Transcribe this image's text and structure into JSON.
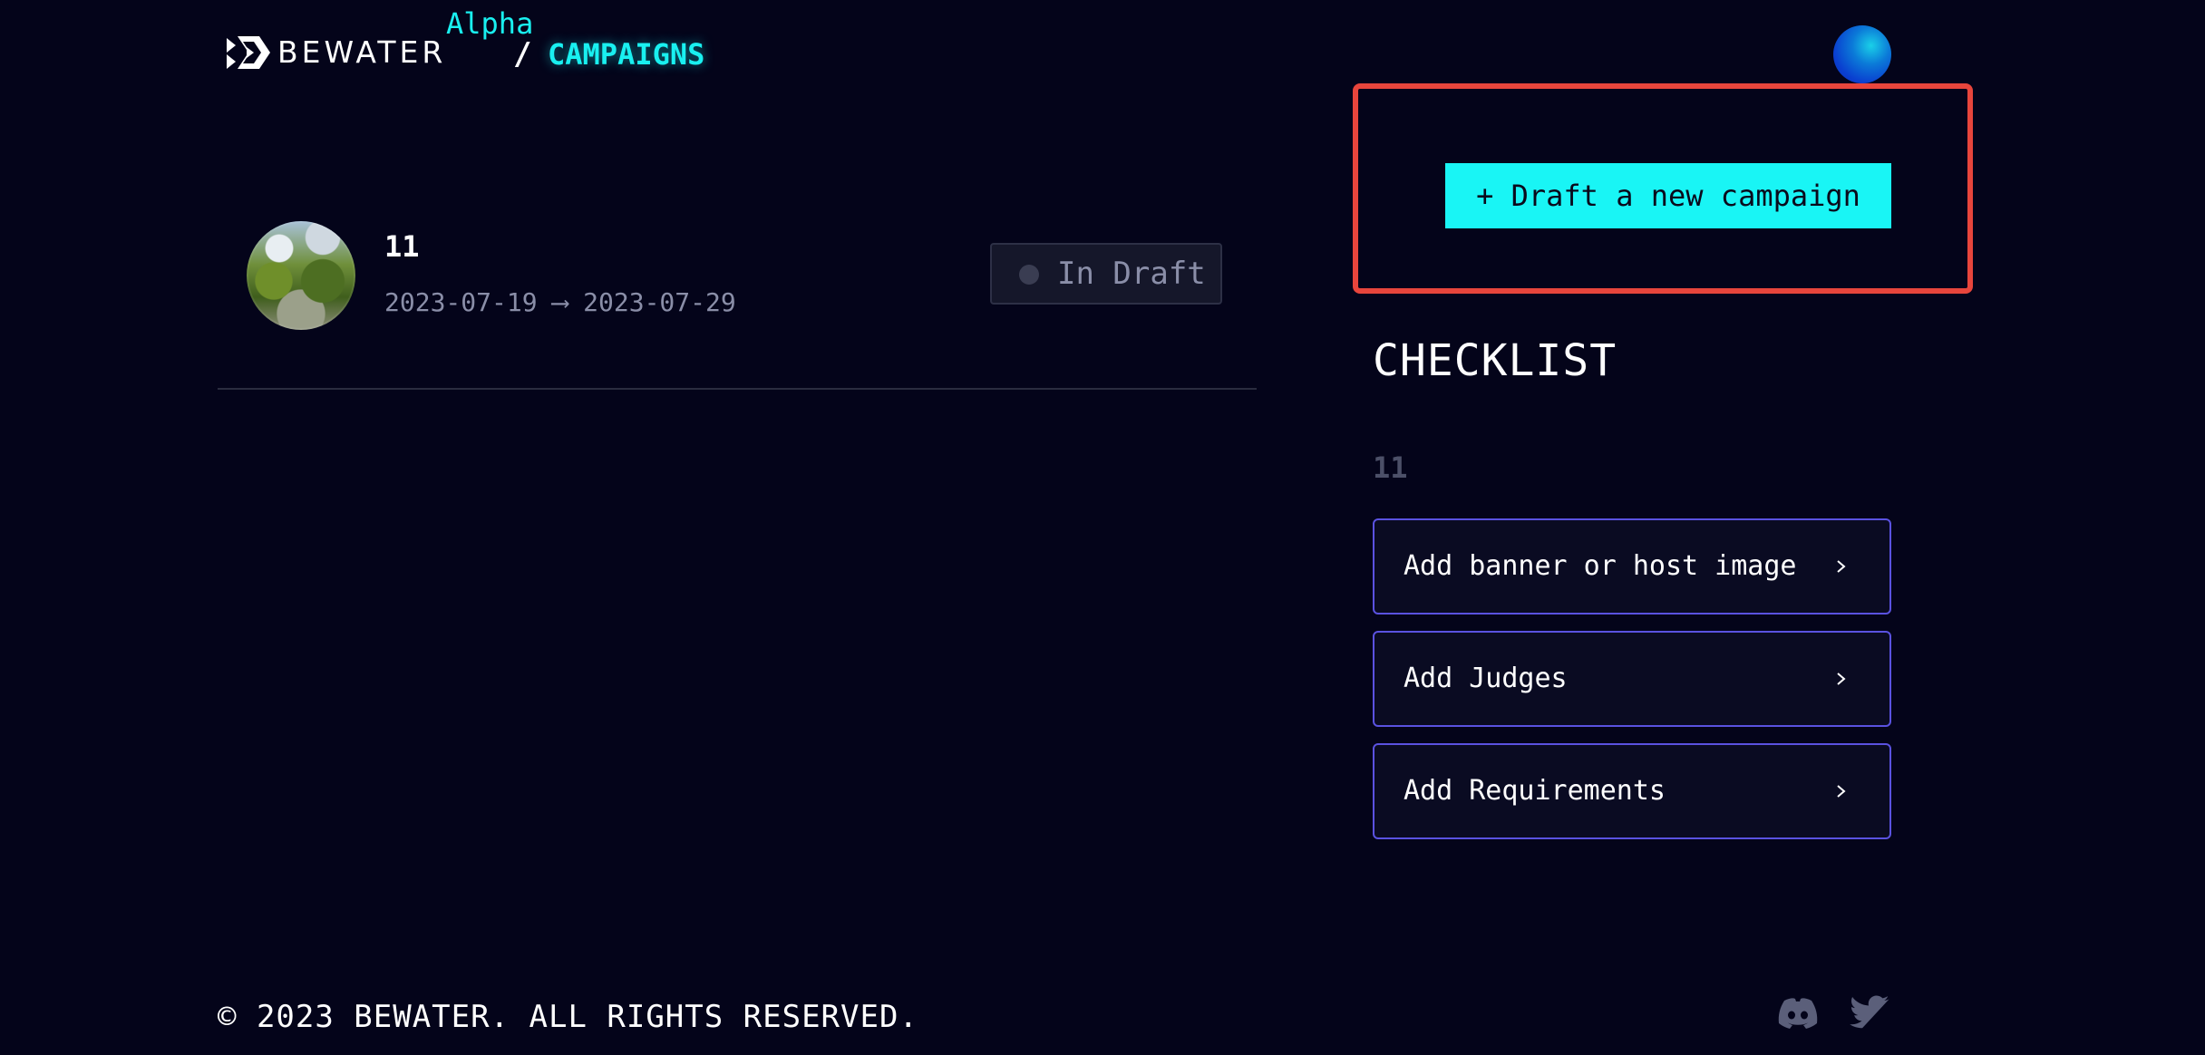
{
  "header": {
    "brand": "BEWATER",
    "alpha_label": "Alpha",
    "breadcrumb_separator": "/",
    "breadcrumb_current": "CAMPAIGNS",
    "accent_color": "#19f0f0"
  },
  "campaigns": [
    {
      "title": "11",
      "dates": "2023-07-19 ⟶ 2023-07-29",
      "status": "In Draft"
    }
  ],
  "actions": {
    "draft_button_label": "+ Draft a new campaign",
    "draft_button_color": "#19f5f5"
  },
  "checklist": {
    "title": "CHECKLIST",
    "campaign_name": "11",
    "items": [
      {
        "label": "Add banner or host image",
        "icon": "chevron-right-icon"
      },
      {
        "label": "Add Judges",
        "icon": "chevron-right-icon"
      },
      {
        "label": "Add Requirements",
        "icon": "chevron-right-icon"
      }
    ],
    "item_border_color": "#5a52e0"
  },
  "footer": {
    "copyright": "© 2023 BEWATER. ALL RIGHTS RESERVED.",
    "social_icons": [
      "discord-icon",
      "twitter-icon"
    ]
  }
}
